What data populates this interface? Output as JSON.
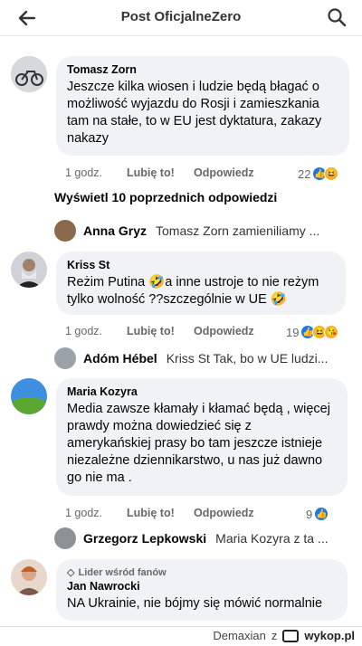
{
  "header": {
    "title": "Post OficjalneZero"
  },
  "comments": [
    {
      "author": "Tomasz Zorn",
      "text": "Jeszcze kilka wiosen i ludzie będą błagać o możliwość wyjazdu do Rosji i zamieszkania tam na stałe, to w EU jest dyktatura, zakazy nakazy",
      "time": "1 godz.",
      "like": "Lubię to!",
      "reply": "Odpowiedz",
      "count": "22"
    },
    {
      "author": "Kriss St",
      "text": "Reżim Putina 🤣a inne ustroje to nie reżym tylko wolność ??szczególnie w UE 🤣",
      "time": "1 godz.",
      "like": "Lubię to!",
      "reply": "Odpowiedz",
      "count": "19"
    },
    {
      "author": "Maria Kozyra",
      "text": "Media zawsze kłamały i kłamać będą , więcej prawdy można dowiedzieć się z amerykańskiej prasy bo tam jeszcze istnieje niezależne dziennikarstwo, u nas już dawno go nie ma .",
      "time": "1 godz.",
      "like": "Lubię to!",
      "reply": "Odpowiedz",
      "count": "9"
    },
    {
      "badge": "Lider wśród fanów",
      "author": "Jan Nawrocki",
      "text": "NA Ukrainie, nie bójmy się mówić normalnie"
    }
  ],
  "previous_replies": "Wyświetl 10 poprzednich odpowiedzi",
  "replies": [
    {
      "name": "Anna Gryz",
      "text": "Tomasz Zorn zamieniliamy ..."
    },
    {
      "name": "Adóm Hébel",
      "text": "Kriss St Tak, bo w UE ludzi..."
    },
    {
      "name": "Grzegorz Lepkowski",
      "text": "Maria Kozyra z ta ..."
    }
  ],
  "footer": {
    "user": "Demaxian",
    "z": "z",
    "site": "wykop.pl"
  }
}
